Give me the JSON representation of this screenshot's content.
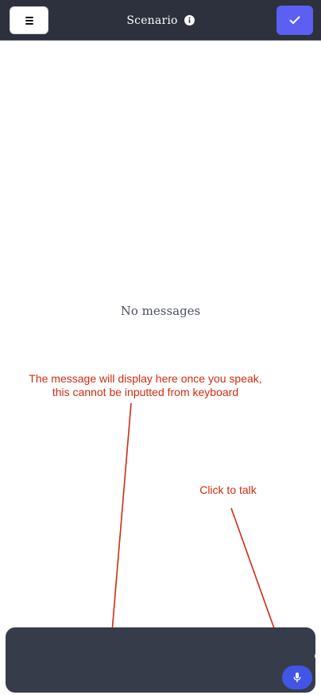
{
  "header": {
    "title": "Scenario",
    "menu_icon": "hamburger-menu-icon",
    "info_icon": "info-circle-icon",
    "confirm_icon": "checkmark-icon"
  },
  "conversation": {
    "empty_text": "No messages"
  },
  "annotations": {
    "message_note": "The message will display here once you speak,\nthis cannot be inputted from keyboard",
    "talk_note": "Click to talk"
  },
  "input_bar": {
    "mic_icon": "microphone-icon"
  },
  "colors": {
    "header_bg": "#2c313d",
    "accent": "#5b5ff2",
    "mic_button": "#4255e6",
    "input_bar_bg": "#373c4a",
    "annotation": "#d42a0f"
  }
}
